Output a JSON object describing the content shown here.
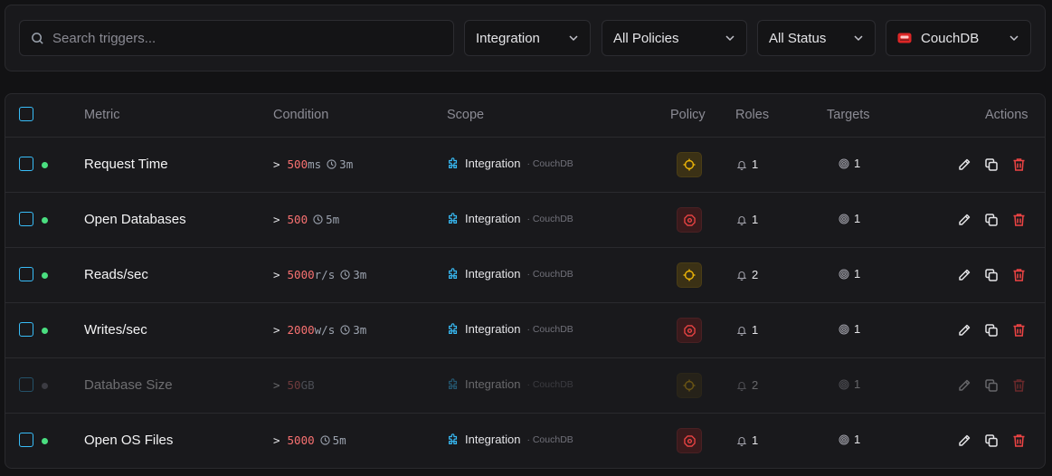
{
  "filters": {
    "search_placeholder": "Search triggers...",
    "integration": "Integration",
    "policies": "All Policies",
    "status": "All Status",
    "database": "CouchDB"
  },
  "table": {
    "headers": {
      "metric": "Metric",
      "condition": "Condition",
      "scope": "Scope",
      "policy": "Policy",
      "roles": "Roles",
      "targets": "Targets",
      "actions": "Actions"
    },
    "rows": [
      {
        "metric": "Request Time",
        "op": ">",
        "value": "500",
        "unit": "ms",
        "duration": "3m",
        "scope": "Integration",
        "scope_db": "· CouchDB",
        "policy": "warning",
        "roles": "1",
        "targets": "1",
        "enabled": true
      },
      {
        "metric": "Open Databases",
        "op": ">",
        "value": "500",
        "unit": "",
        "duration": "5m",
        "scope": "Integration",
        "scope_db": "· CouchDB",
        "policy": "critical",
        "roles": "1",
        "targets": "1",
        "enabled": true
      },
      {
        "metric": "Reads/sec",
        "op": ">",
        "value": "5000",
        "unit": "r/s",
        "duration": "3m",
        "scope": "Integration",
        "scope_db": "· CouchDB",
        "policy": "warning",
        "roles": "2",
        "targets": "1",
        "enabled": true
      },
      {
        "metric": "Writes/sec",
        "op": ">",
        "value": "2000",
        "unit": "w/s",
        "duration": "3m",
        "scope": "Integration",
        "scope_db": "· CouchDB",
        "policy": "critical",
        "roles": "1",
        "targets": "1",
        "enabled": true
      },
      {
        "metric": "Database Size",
        "op": ">",
        "value": "50",
        "unit": "GB",
        "duration": "",
        "scope": "Integration",
        "scope_db": "· CouchDB",
        "policy": "warning",
        "roles": "2",
        "targets": "1",
        "enabled": false
      },
      {
        "metric": "Open OS Files",
        "op": ">",
        "value": "5000",
        "unit": "",
        "duration": "5m",
        "scope": "Integration",
        "scope_db": "· CouchDB",
        "policy": "critical",
        "roles": "1",
        "targets": "1",
        "enabled": true
      }
    ]
  },
  "colors": {
    "accent": "#38bdf8",
    "active_dot": "#4ade80",
    "danger": "#f87171",
    "warning": "#eab308",
    "critical": "#ef4444"
  },
  "icons": {
    "search": "search-icon",
    "chevron": "chevron-down-icon",
    "database": "database-icon",
    "clock": "clock-icon",
    "integration": "puzzle-icon",
    "bell": "bell-icon",
    "target": "target-icon",
    "edit": "pencil-icon",
    "copy": "copy-icon",
    "delete": "trash-icon"
  }
}
